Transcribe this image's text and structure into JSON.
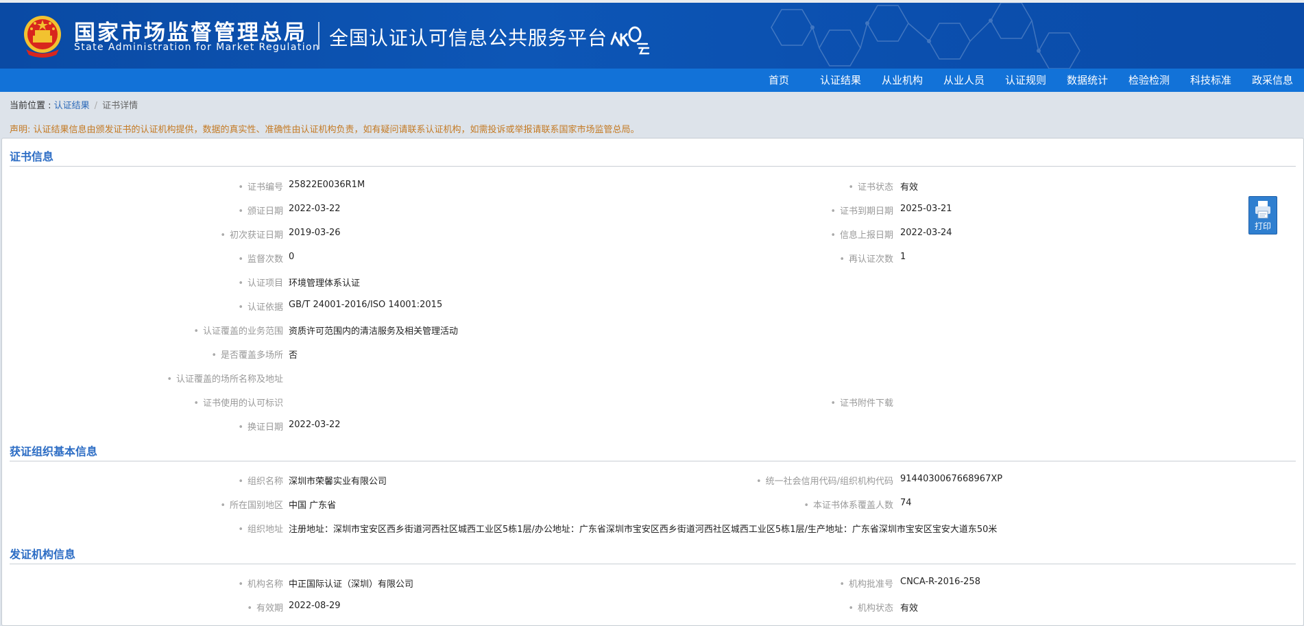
{
  "header": {
    "logo_cn": "国家市场监督管理总局",
    "logo_en": "State Administration  for  Market Regulation",
    "platform_title": "全国认证认可信息公共服务平台",
    "rz_logo_text": "认云"
  },
  "nav": [
    "首页",
    "认证结果",
    "从业机构",
    "从业人员",
    "认证规则",
    "数据统计",
    "检验检测",
    "科技标准",
    "政采信息"
  ],
  "breadcrumb": {
    "prefix": "当前位置 :",
    "item1": "认证结果",
    "sep": "/",
    "item2": "证书详情"
  },
  "notice": "声明: 认证结果信息由颁发证书的认证机构提供，数据的真实性、准确性由认证机构负责，如有疑问请联系认证机构，如需投诉或举报请联系国家市场监管总局。",
  "print_label": "打印",
  "cert_section": {
    "title": "证书信息",
    "left": [
      {
        "label": "证书编号",
        "value": "25822E0036R1M"
      },
      {
        "label": "颁证日期",
        "value": "2022-03-22"
      },
      {
        "label": "初次获证日期",
        "value": "2019-03-26"
      },
      {
        "label": "监督次数",
        "value": "0"
      },
      {
        "label": "认证项目",
        "value": "环境管理体系认证"
      },
      {
        "label": "认证依据",
        "value": "GB/T 24001-2016/ISO 14001:2015"
      },
      {
        "label": "认证覆盖的业务范围",
        "value": "资质许可范围内的清洁服务及相关管理活动"
      },
      {
        "label": "是否覆盖多场所",
        "value": "否"
      },
      {
        "label": "认证覆盖的场所名称及地址",
        "value": ""
      },
      {
        "label": "证书使用的认可标识",
        "value": ""
      },
      {
        "label": "换证日期",
        "value": "2022-03-22"
      }
    ],
    "right": [
      {
        "label": "证书状态",
        "value": "有效"
      },
      {
        "label": "证书到期日期",
        "value": "2025-03-21"
      },
      {
        "label": "信息上报日期",
        "value": "2022-03-24"
      },
      {
        "label": "再认证次数",
        "value": "1"
      },
      {
        "label": "证书附件下载",
        "value": ""
      }
    ]
  },
  "org_section": {
    "title": "获证组织基本信息",
    "name_label": "组织名称",
    "name_value": "深圳市荣馨实业有限公司",
    "credit_label": "统一社会信用代码/组织机构代码",
    "credit_value": "9144030067668967XP",
    "region_label": "所在国别地区",
    "region_value": "中国 广东省",
    "people_label": "本证书体系覆盖人数",
    "people_value": "74",
    "addr_label": "组织地址",
    "addr_value": "注册地址：深圳市宝安区西乡街道河西社区城西工业区5栋1层/办公地址：广东省深圳市宝安区西乡街道河西社区城西工业区5栋1层/生产地址：广东省深圳市宝安区宝安大道东50米"
  },
  "issuer_section": {
    "title": "发证机构信息",
    "name_label": "机构名称",
    "name_value": "中正国际认证（深圳）有限公司",
    "approval_label": "机构批准号",
    "approval_value": "CNCA-R-2016-258",
    "valid_label": "有效期",
    "valid_value": "2022-08-29",
    "status_label": "机构状态",
    "status_value": "有效"
  }
}
